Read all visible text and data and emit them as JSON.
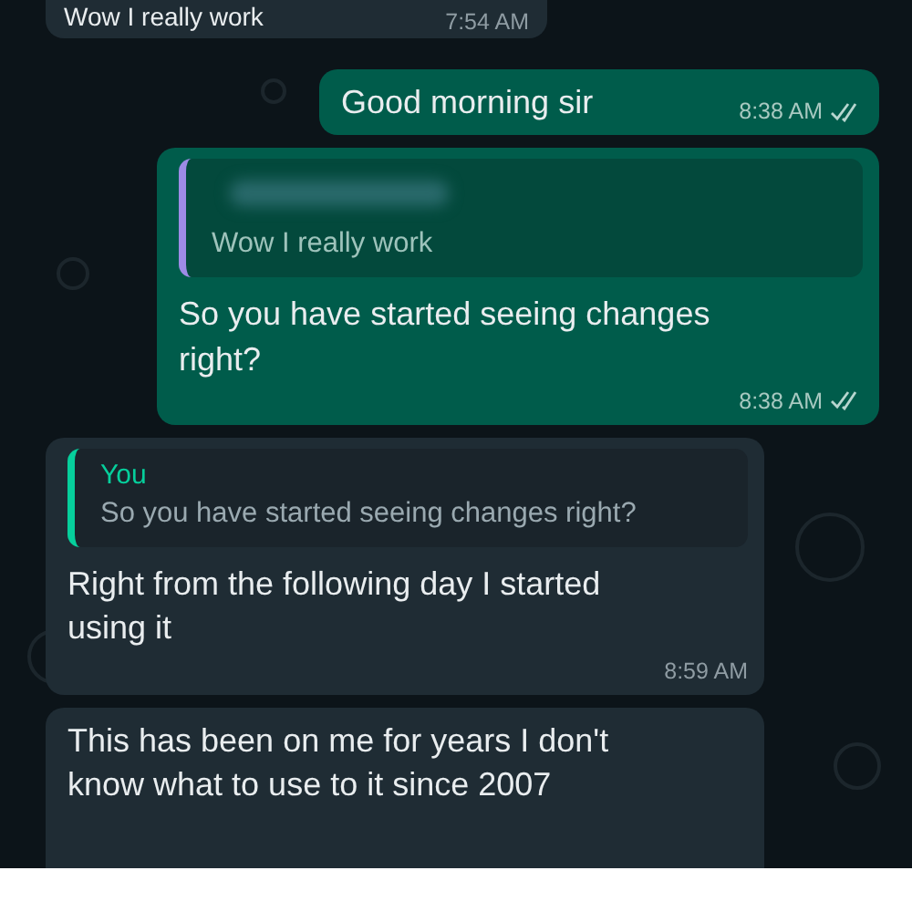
{
  "messages": [
    {
      "kind": "incoming",
      "text": "Wow I really work",
      "time": "7:54 AM"
    },
    {
      "kind": "outgoing",
      "text": "Good morning sir",
      "time": "8:38 AM",
      "ticks": true
    },
    {
      "kind": "outgoing",
      "quote": {
        "author_hidden": true,
        "text": "Wow I really work"
      },
      "text": "So you have started seeing changes right?",
      "time": "8:38 AM",
      "ticks": true
    },
    {
      "kind": "incoming",
      "quote": {
        "author": "You",
        "text": "So you have started seeing changes right?"
      },
      "text": "Right from the following day I started using it",
      "time": "8:59 AM"
    },
    {
      "kind": "incoming",
      "text": "This has been on me for years I don't know what to use to it since 2007"
    }
  ]
}
